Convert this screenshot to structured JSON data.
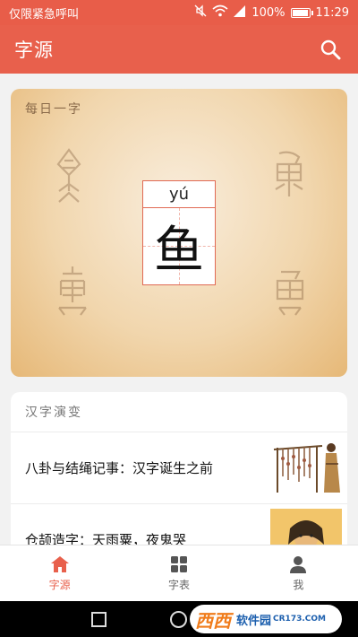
{
  "status_bar": {
    "carrier": "仅限紧急呼叫",
    "battery_text": "100%",
    "battery_level": 1.0,
    "time": "11:29",
    "icons": [
      "mute-icon",
      "wifi-icon",
      "signal-icon",
      "battery-icon"
    ]
  },
  "app_bar": {
    "title": "字源",
    "search_icon": "search-icon"
  },
  "daily": {
    "label": "每日一字",
    "pinyin": "yú",
    "character": "鱼"
  },
  "evolution": {
    "title": "汉字演变",
    "items": [
      {
        "title": "八卦与结绳记事：汉字诞生之前"
      },
      {
        "title": "仓颉造字：天雨粟，夜鬼哭"
      }
    ]
  },
  "bottom_nav": [
    {
      "label": "字源",
      "icon": "home-icon",
      "active": true
    },
    {
      "label": "字表",
      "icon": "grid-icon",
      "active": false
    },
    {
      "label": "我",
      "icon": "person-icon",
      "active": false
    }
  ],
  "watermark": {
    "text_a": "西西",
    "text_b": "软件园",
    "text_c": "CR173.COM"
  },
  "colors": {
    "accent": "#e8604c",
    "card_bg": "#f1d6ad"
  }
}
